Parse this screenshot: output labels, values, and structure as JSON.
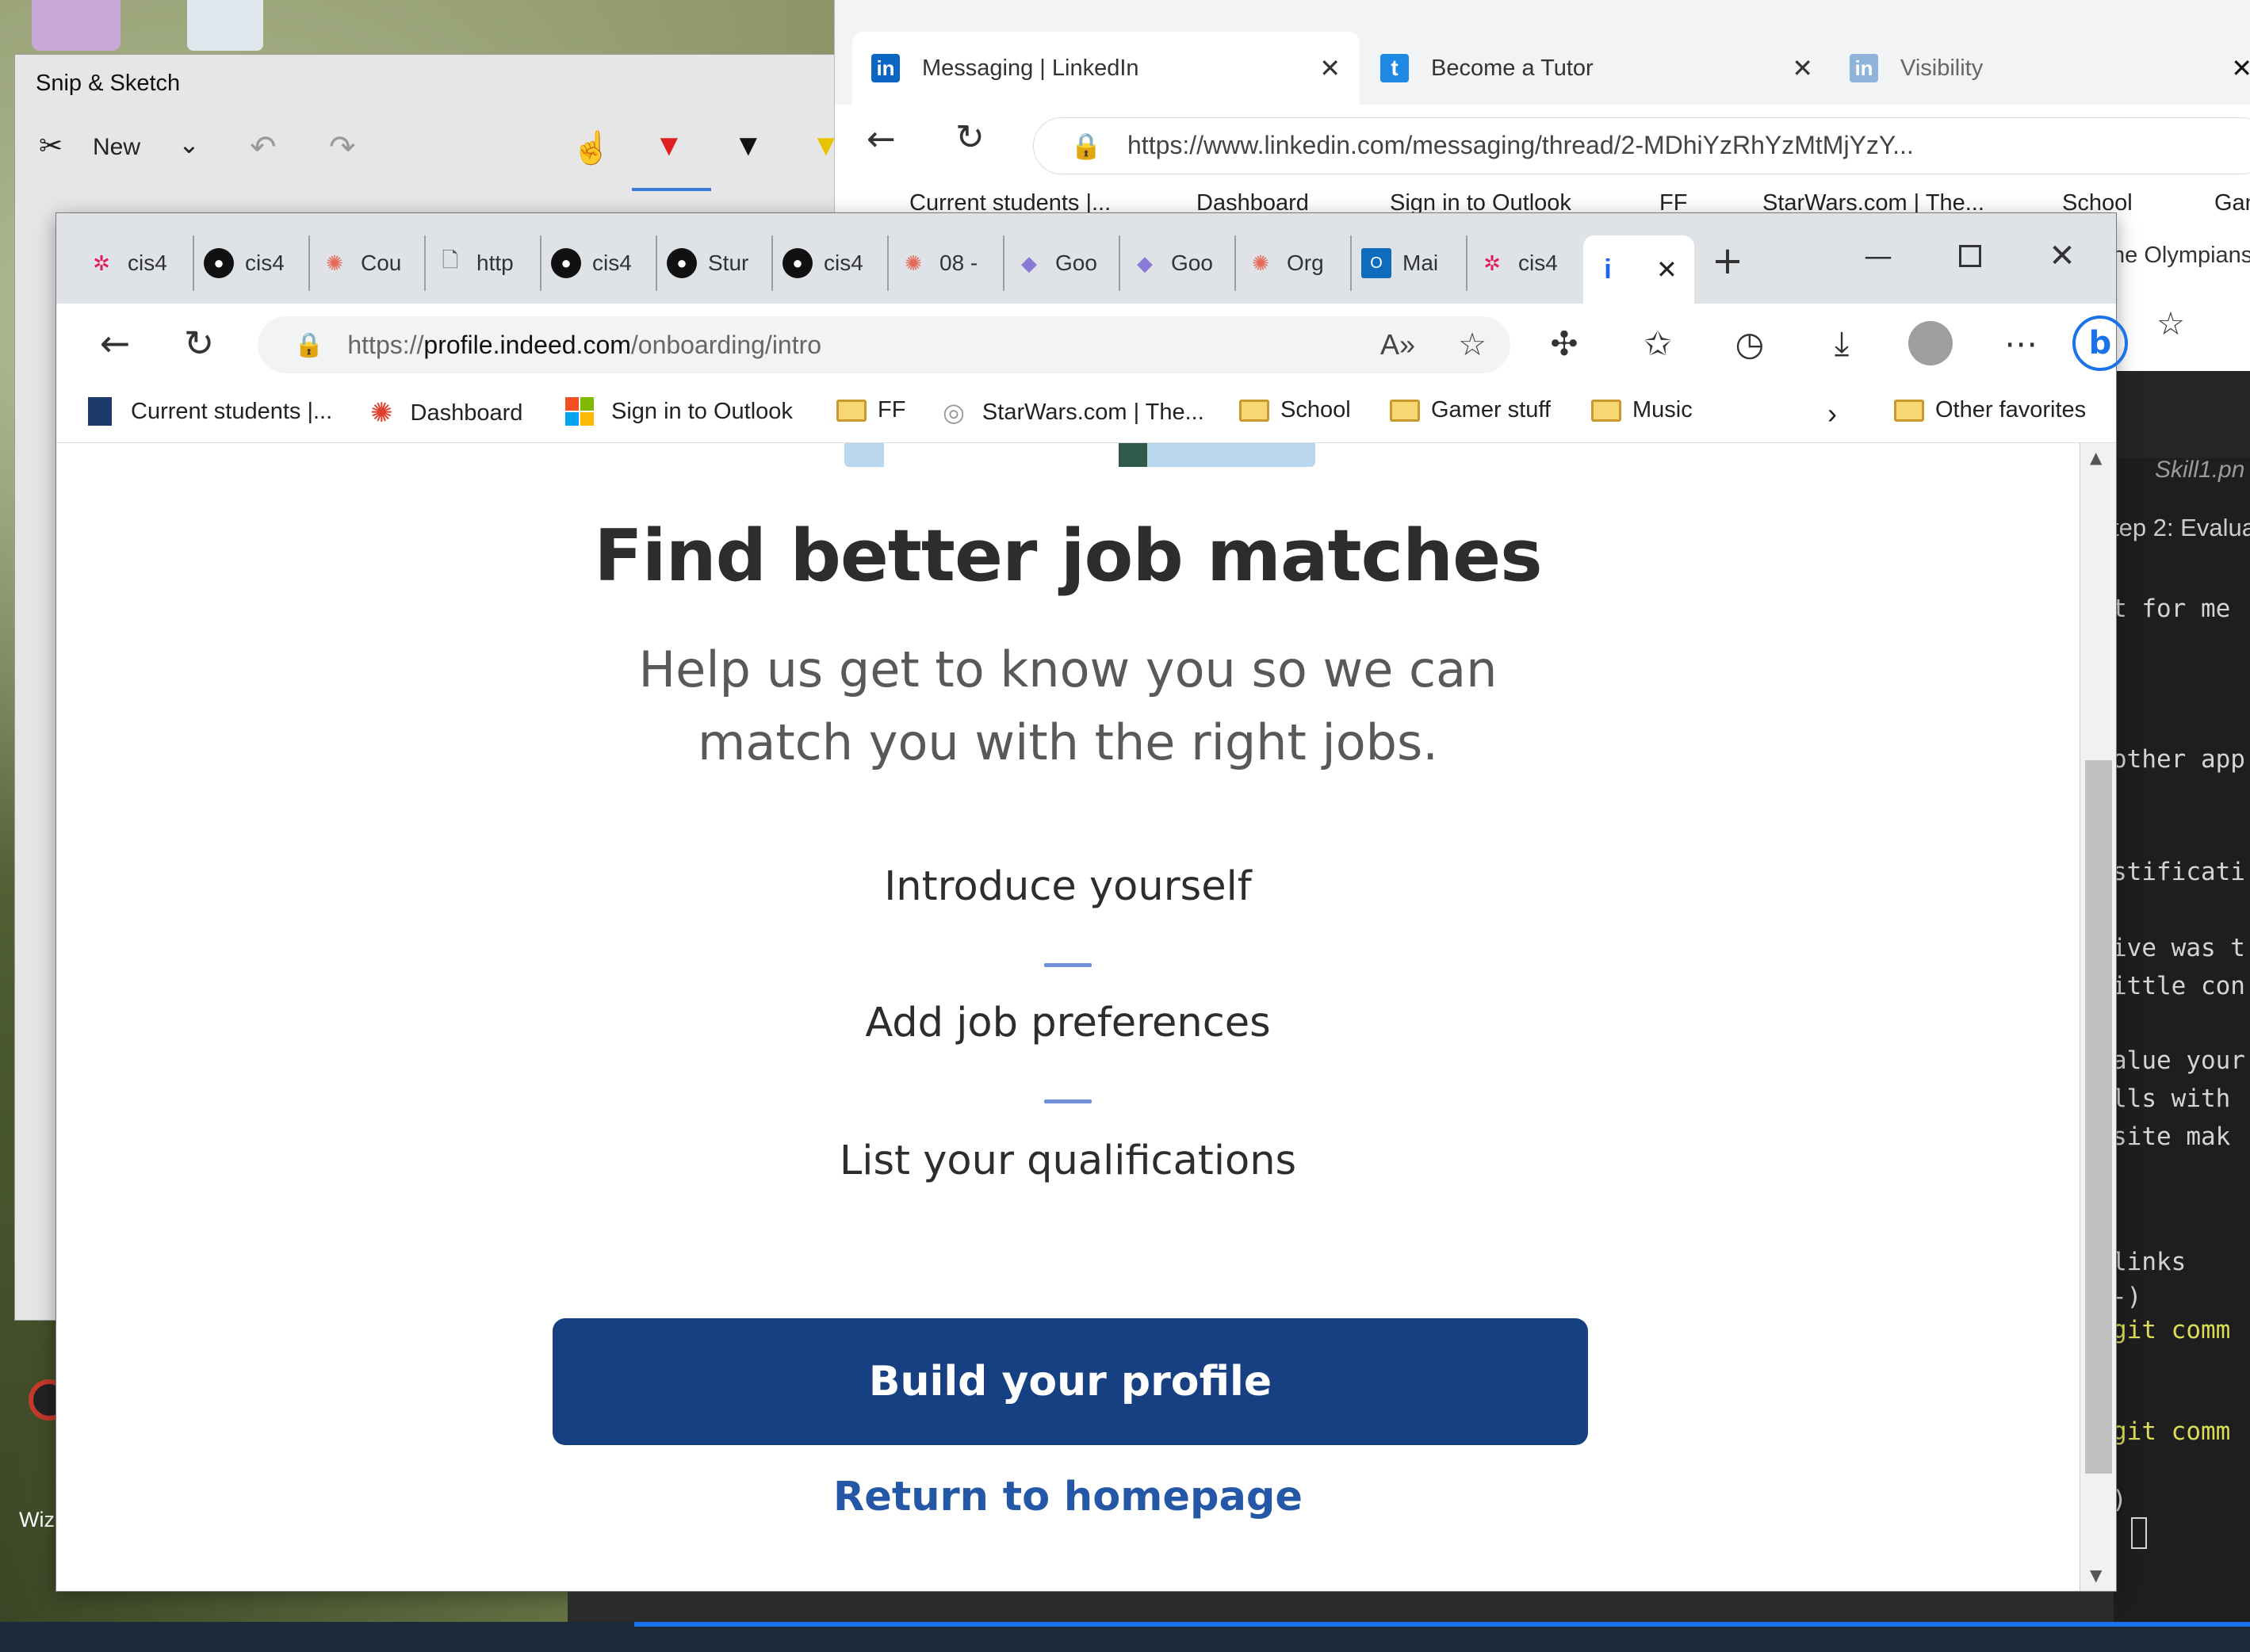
{
  "snip": {
    "title": "Snip & Sketch",
    "new_label": "New"
  },
  "linkedin": {
    "tabs": [
      {
        "label": "Messaging | LinkedIn"
      },
      {
        "label": "Become a Tutor"
      },
      {
        "label": "Visibility"
      }
    ],
    "url": "https://www.linkedin.com/messaging/thread/2-MDhiYzRhYzMtMjYzY...",
    "favorites": [
      "Current students |...",
      "Dashboard",
      "Sign in to Outlook",
      "FF",
      "StarWars.com | The...",
      "School",
      "Gan"
    ],
    "side_text": "he Olympians"
  },
  "editor": {
    "file_tab": "Skill1.pn",
    "heading": "tep 2: Evalua",
    "lines": [
      {
        "text": "t for me",
        "hl": false
      },
      {
        "text": "other app",
        "hl": false
      },
      {
        "text": "stificati",
        "hl": false
      },
      {
        "text": "ive was t",
        "hl": false
      },
      {
        "text": "ittle con",
        "hl": false
      },
      {
        "text": "alue your",
        "hl": false
      },
      {
        "text": "lls with",
        "hl": false
      },
      {
        "text": " site mak",
        "hl": false
      },
      {
        "text": " links",
        "hl": false
      },
      {
        "text": "-)",
        "hl": false
      },
      {
        "text": " git comm",
        "hl": true
      },
      {
        "text": " git comm",
        "hl": true
      },
      {
        "text": ")",
        "hl": false
      }
    ]
  },
  "desktop": {
    "icon_label": "Wiz"
  },
  "browser": {
    "tabs": [
      {
        "label": "cis4",
        "icon": "slack-icon"
      },
      {
        "label": "cis4",
        "icon": "github-icon"
      },
      {
        "label": "Cou",
        "icon": "canvas-icon"
      },
      {
        "label": "http",
        "icon": "page-icon"
      },
      {
        "label": "cis4",
        "icon": "github-icon"
      },
      {
        "label": "Stur",
        "icon": "github-icon"
      },
      {
        "label": "cis4",
        "icon": "github-icon"
      },
      {
        "label": "08 -",
        "icon": "canvas-icon"
      },
      {
        "label": "Goo",
        "icon": "slides-icon"
      },
      {
        "label": "Goo",
        "icon": "slides-icon"
      },
      {
        "label": "Org",
        "icon": "canvas-icon"
      },
      {
        "label": "Mai",
        "icon": "outlook-icon"
      },
      {
        "label": "cis4",
        "icon": "slack-icon"
      }
    ],
    "url_prefix": "https://",
    "url_domain": "profile.indeed.com",
    "url_path": "/onboarding/intro",
    "favorites": [
      {
        "label": "Current students |...",
        "icon": "university-icon"
      },
      {
        "label": "Dashboard",
        "icon": "canvas-icon"
      },
      {
        "label": "Sign in to Outlook",
        "icon": "microsoft-icon"
      },
      {
        "label": "FF",
        "icon": "folder-icon"
      },
      {
        "label": "StarWars.com | The...",
        "icon": "globe-icon"
      },
      {
        "label": "School",
        "icon": "folder-icon"
      },
      {
        "label": "Gamer stuff",
        "icon": "folder-icon"
      },
      {
        "label": "Music",
        "icon": "folder-icon"
      }
    ],
    "other_favorites": "Other favorites"
  },
  "page": {
    "heading": "Find better job matches",
    "subheading": "Help us get to know you so we can match you with the right jobs.",
    "steps": [
      "Introduce yourself",
      "Add job preferences",
      "List your qualifications"
    ],
    "primary_button": "Build your profile",
    "secondary_link": "Return to homepage"
  },
  "colors": {
    "primary": "#164081",
    "link": "#2557a7",
    "step_divider": "#6f8fd6"
  }
}
